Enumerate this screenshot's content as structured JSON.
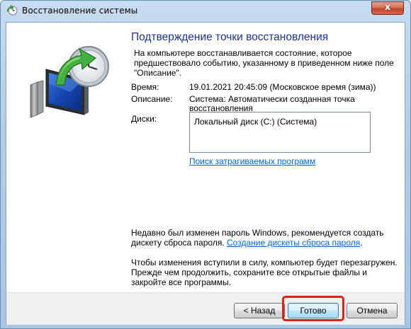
{
  "window": {
    "title": "Восстановление системы",
    "close_glyph": "x"
  },
  "content": {
    "heading": "Подтверждение точки восстановления",
    "intro_line1": "На компьютере восстанавливается состояние, которое",
    "intro_line2": "предшествовало событию, указанному в приведенном ниже поле",
    "intro_line3": "\"Описание\".",
    "time_label": "Время:",
    "time_value": "19.01.2021 20:45:09 (Московское время (зима))",
    "desc_label": "Описание:",
    "desc_value_line1": "Система: Автоматически созданная точка",
    "desc_value_line2": "восстановления",
    "disks_label": "Диски:",
    "disks": [
      "Локальный диск (C:) (Система)"
    ],
    "scan_link": "Поиск затрагиваемых программ",
    "password_line1": "Недавно был изменен пароль Windows, рекомендуется создать",
    "password_line2_prefix": "дискету сброса пароля.",
    "password_link": "Создание дискеты сброса пароля",
    "password_line2_suffix": ".",
    "restart_line1": "Чтобы изменения вступили в силу, компьютер будет перезагружен.",
    "restart_line2": "Прежде чем продолжить, сохраните все открытые файлы и",
    "restart_line3": "закройте все программы."
  },
  "buttons": {
    "back": "< Назад",
    "finish": "Готово",
    "cancel": "Отмена"
  },
  "icons": {
    "title_icon": "system-restore-icon",
    "illustration": "system-restore-computer-clock-icon"
  },
  "colors": {
    "heading": "#1e3287",
    "link": "#0066cc",
    "highlight": "#e0201b"
  }
}
